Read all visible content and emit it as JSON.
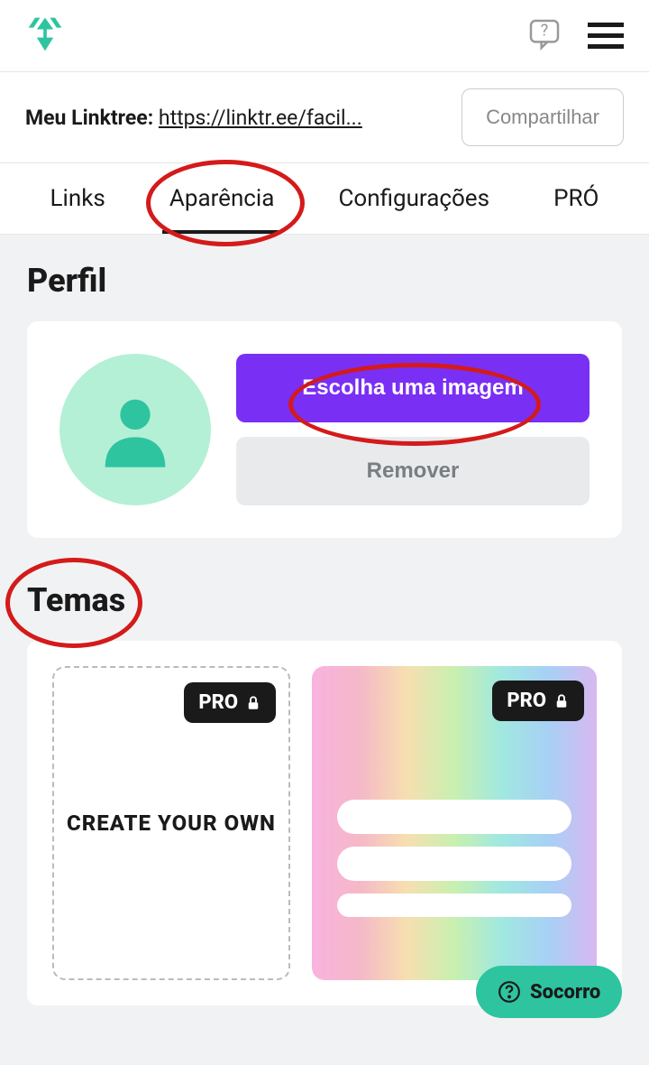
{
  "header": {
    "share_label": "Compartilhar"
  },
  "linktree": {
    "label": "Meu Linktree: ",
    "url": "https://linktr.ee/facil..."
  },
  "tabs": [
    "Links",
    "Aparência",
    "Configurações",
    "PRÓ"
  ],
  "profile": {
    "section_title": "Perfil",
    "choose_image": "Escolha uma imagem",
    "remove": "Remover"
  },
  "themes": {
    "section_title": "Temas",
    "custom_label": "CREATE YOUR OWN",
    "pro_badge": "PRO"
  },
  "help": {
    "label": "Socorro"
  },
  "colors": {
    "brand": "#2ec4a0",
    "primary": "#7a2ff5",
    "annotation": "#d41a1a"
  }
}
